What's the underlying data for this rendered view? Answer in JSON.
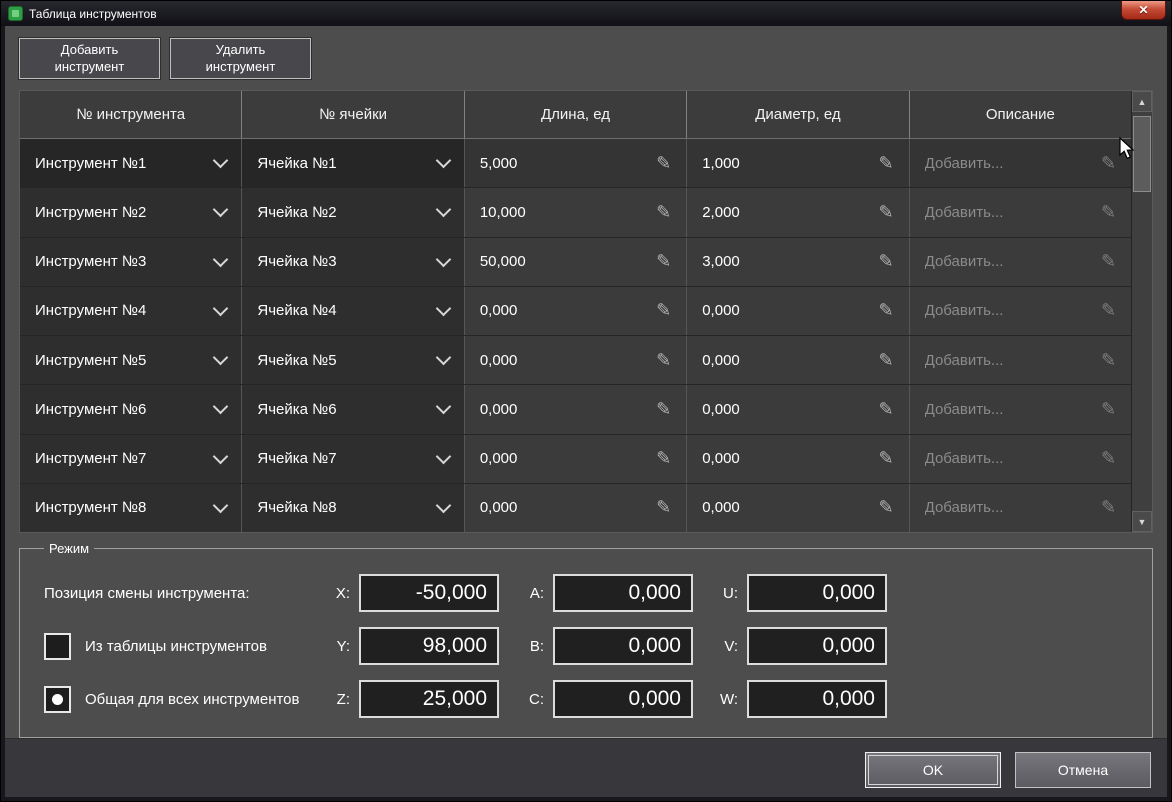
{
  "window": {
    "title": "Таблица инструментов",
    "close_label": "✕"
  },
  "toolbar": {
    "add_button": "Добавить\nинструмент",
    "delete_button": "Удалить\nинструмент"
  },
  "table": {
    "headers": [
      "№ инструмента",
      "№ ячейки",
      "Длина, ед",
      "Диаметр, ед",
      "Описание"
    ],
    "rows": [
      {
        "tool": "Инструмент №1",
        "cell": "Ячейка №1",
        "length": "5,000",
        "diameter": "1,000",
        "description": "Добавить..."
      },
      {
        "tool": "Инструмент №2",
        "cell": "Ячейка №2",
        "length": "10,000",
        "diameter": "2,000",
        "description": "Добавить..."
      },
      {
        "tool": "Инструмент №3",
        "cell": "Ячейка №3",
        "length": "50,000",
        "diameter": "3,000",
        "description": "Добавить..."
      },
      {
        "tool": "Инструмент №4",
        "cell": "Ячейка №4",
        "length": "0,000",
        "diameter": "0,000",
        "description": "Добавить..."
      },
      {
        "tool": "Инструмент №5",
        "cell": "Ячейка №5",
        "length": "0,000",
        "diameter": "0,000",
        "description": "Добавить..."
      },
      {
        "tool": "Инструмент №6",
        "cell": "Ячейка №6",
        "length": "0,000",
        "diameter": "0,000",
        "description": "Добавить..."
      },
      {
        "tool": "Инструмент №7",
        "cell": "Ячейка №7",
        "length": "0,000",
        "diameter": "0,000",
        "description": "Добавить..."
      },
      {
        "tool": "Инструмент №8",
        "cell": "Ячейка №8",
        "length": "0,000",
        "diameter": "0,000",
        "description": "Добавить..."
      }
    ]
  },
  "scrollbar": {
    "up_icon": "▲",
    "down_icon": "▼"
  },
  "mode": {
    "legend": "Режим",
    "rows": [
      {
        "control": "none",
        "checked": false,
        "label": "Позиция смены инструмента:",
        "fields": [
          {
            "axis": "X:",
            "value": "-50,000"
          },
          {
            "axis": "A:",
            "value": "0,000"
          },
          {
            "axis": "U:",
            "value": "0,000"
          }
        ]
      },
      {
        "control": "checkbox",
        "checked": false,
        "label": "Из таблицы инструментов",
        "fields": [
          {
            "axis": "Y:",
            "value": "98,000"
          },
          {
            "axis": "B:",
            "value": "0,000"
          },
          {
            "axis": "V:",
            "value": "0,000"
          }
        ]
      },
      {
        "control": "radio",
        "checked": true,
        "label": "Общая для всех инструментов",
        "fields": [
          {
            "axis": "Z:",
            "value": "25,000"
          },
          {
            "axis": "C:",
            "value": "0,000"
          },
          {
            "axis": "W:",
            "value": "0,000"
          }
        ]
      }
    ]
  },
  "footer": {
    "ok": "OK",
    "cancel": "Отмена"
  },
  "colors": {
    "dialog_bg": "#4d4d4d",
    "table_dropdown_cell": "#2e2e2e",
    "table_edit_cell": "#3b3b3b",
    "close_button_red": "#c44b35",
    "app_icon_green": "#2f9d43"
  }
}
